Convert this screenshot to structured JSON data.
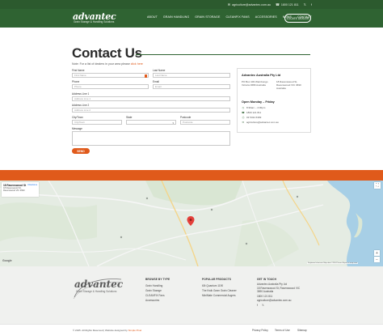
{
  "topbar": {
    "email": "agriculture@advantec.com.au",
    "phone": "1800 121 811",
    "social": [
      "x-icon",
      "facebook-icon"
    ]
  },
  "header": {
    "logo_word": "advantec",
    "logo_sub": "Grain Storage & Handling Solutions",
    "nav": [
      "ABOUT",
      "GRAIN HANDLING",
      "GRAIN STORAGE",
      "CLEANFIX FANS",
      "ACCESSORIES",
      "NEWS",
      "CONTACT"
    ],
    "dealer_button": "LOCATE DEALER"
  },
  "contact": {
    "title": "Contact Us",
    "note_prefix": "Note: For a list of dealers in your area please",
    "note_link": "click here",
    "form": {
      "first_name_label": "First Name",
      "first_name_placeholder": "First Name",
      "last_name_label": "Last Name",
      "last_name_placeholder": "Last Name",
      "phone_label": "Phone",
      "phone_placeholder": "Phone",
      "email_label": "Email",
      "email_placeholder": "Email",
      "address1_label": "Address Line 1",
      "address1_placeholder": "Address Line 1",
      "address2_label": "Address Line 2",
      "address2_placeholder": "Address Line 2",
      "city_label": "City/Town",
      "city_placeholder": "City/Town",
      "state_label": "State",
      "postcode_label": "Postcode",
      "postcode_placeholder": "Postcode",
      "message_label": "Message",
      "send_button": "SEND"
    },
    "card": {
      "company": "Advantec Australia Pty Ltd",
      "address_left": "PO Box 403 Warnbungo Victoria 3689 Australia",
      "address_right": "18 Ravenswood St, Ravenswood VIC 3690 Australia",
      "hours_title": "Open Monday – Friday",
      "hours": "8:30am – 4:30pm",
      "phone": "1800 121 811",
      "fax": "03 5434 6399",
      "email": "agriculture@advantec.com.au"
    }
  },
  "map": {
    "card_title": "18 Ravenswood St",
    "card_address": "18 Ravenswood St, Ravenswood VIC 3690",
    "directions": "Directions",
    "google": "Google",
    "attribution": "Keyboard shortcuts  Map data ©2024  Terms  Report a map error"
  },
  "footer": {
    "logo_word": "advantec",
    "logo_sub": "Grain Storage & Handling Solutions",
    "col1_title": "BROWSE BY TYPE",
    "col1_links": [
      "Grain Handling",
      "Grain Storage",
      "CLEANFIX Fans",
      "Accessories"
    ],
    "col2_title": "POPULAR PRODUCTS",
    "col2_links": [
      "60t Quantum 1190",
      "The Kwik Gram Grain Cleaner",
      "MiniMate Commercial Augers"
    ],
    "col3_title": "GET IN TOUCH",
    "col3_lines": [
      "Advantec Australia Pty Ltd",
      "18 Ravenswood St, Ravenswood VIC 3690 Australia",
      "1800 121 811",
      "agriculture@advantec.com.au"
    ]
  },
  "bottom": {
    "copyright": "© 2025. All Rights Reserved | Website designed by",
    "designer": "Simple Pixel",
    "links": [
      "Privacy Policy",
      "Terms of Use",
      "Sitemap"
    ]
  },
  "colors": {
    "brand_green": "#2f6332",
    "accent_orange": "#e05a1b"
  }
}
